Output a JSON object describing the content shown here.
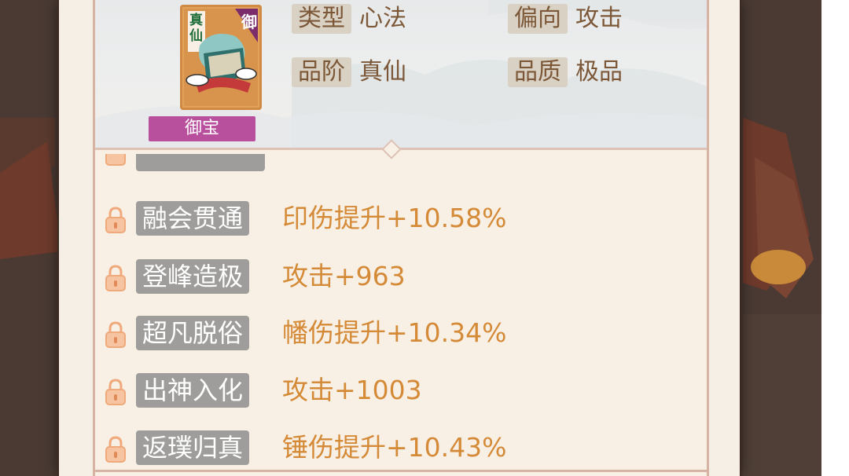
{
  "item": {
    "icon_grade_text": "真仙",
    "icon_badge_text": "御",
    "quality_tag": "御宝"
  },
  "info": {
    "type_label": "类型",
    "type_value": "心法",
    "bias_label": "偏向",
    "bias_value": "攻击",
    "rank_label": "品阶",
    "rank_value": "真仙",
    "quality_label": "品质",
    "quality_value": "极品"
  },
  "traits": [
    {
      "name": "融会贯通",
      "effect": "印伤提升+10.58%"
    },
    {
      "name": "登峰造极",
      "effect": "攻击+963"
    },
    {
      "name": "超凡脱俗",
      "effect": "幡伤提升+10.34%"
    },
    {
      "name": "出神入化",
      "effect": "攻击+1003"
    },
    {
      "name": "返璞归真",
      "effect": "锤伤提升+10.43%"
    }
  ],
  "colors": {
    "trait_effect": "#d48a36",
    "trait_name_bg": "#9e9d9b",
    "quality_tag_bg": "#b8509d",
    "info_text": "#7d5838"
  },
  "icons": {
    "lock": "padlock-icon",
    "item_art": "scroll-artifact-icon"
  }
}
